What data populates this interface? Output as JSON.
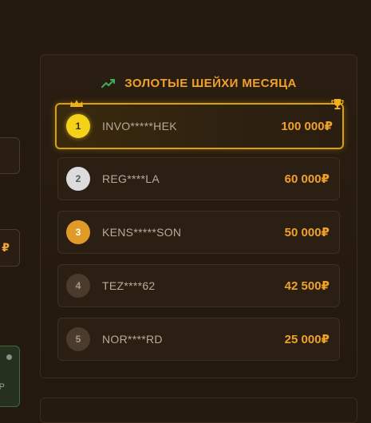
{
  "side": {
    "card2_text": "₽",
    "card3_text": "Р"
  },
  "leaderboard": {
    "title": "ЗОЛОТЫЕ ШЕЙХИ МЕСЯЦА",
    "entries": [
      {
        "rank": "1",
        "name": "INVO*****HEK",
        "amount": "100 000₽",
        "badge_color": "#f5d21a",
        "badge_text_color": "#3a2a00"
      },
      {
        "rank": "2",
        "name": "REG****LA",
        "amount": "60 000₽",
        "badge_color": "#dcdcdc",
        "badge_text_color": "#555555"
      },
      {
        "rank": "3",
        "name": "KENS*****SON",
        "amount": "50 000₽",
        "badge_color": "#e09a28",
        "badge_text_color": "#ffffff"
      },
      {
        "rank": "4",
        "name": "TEZ****62",
        "amount": "42 500₽",
        "badge_color": "#4a3b2c",
        "badge_text_color": "#a8998a"
      },
      {
        "rank": "5",
        "name": "NOR****RD",
        "amount": "25 000₽",
        "badge_color": "#4a3b2c",
        "badge_text_color": "#a8998a"
      }
    ]
  },
  "colors": {
    "accent": "#f0a12a",
    "trend": "#3fae5a",
    "gold_border": "#d9a10e"
  },
  "icons": {
    "trend": "trending-up-icon",
    "crown": "crown-icon",
    "trophy": "trophy-icon"
  }
}
